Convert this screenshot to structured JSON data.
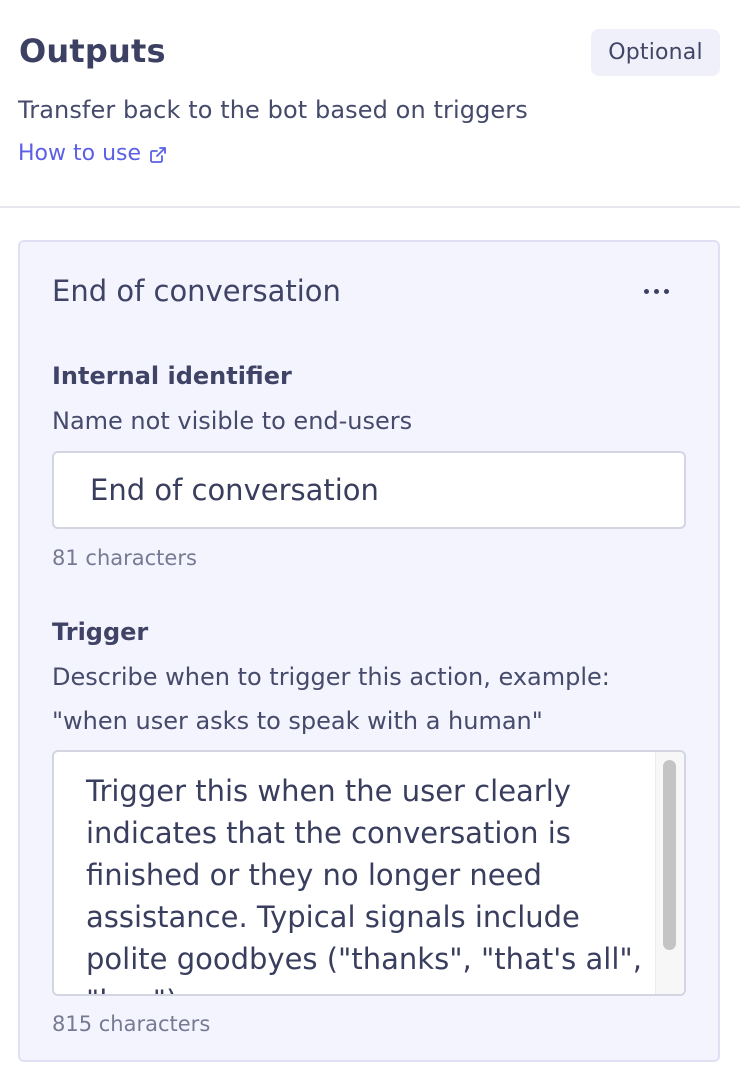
{
  "header": {
    "title": "Outputs",
    "badge": "Optional",
    "subtitle": "Transfer back to the bot based on triggers",
    "link_label": "How to use",
    "link_icon": "external-link-icon"
  },
  "card": {
    "title": "End of conversation",
    "menu_icon": "more-horizontal-icon",
    "identifier": {
      "label": "Internal identifier",
      "help": "Name not visible to end-users",
      "value": "End of conversation",
      "count": "81 characters"
    },
    "trigger": {
      "label": "Trigger",
      "help_line1": "Describe when to trigger this action, example:",
      "help_line2": "\"when user asks to speak with a human\"",
      "value": "Trigger this when the user clearly indicates that the conversation is finished or they no longer need assistance. Typical signals include polite goodbyes (\"thanks\", \"that's all\", \"bye\")",
      "count": "815 characters"
    }
  },
  "colors": {
    "accent": "#5b60e6",
    "text": "#3f4366",
    "card_bg": "#f3f4fd",
    "badge_bg": "#eff0fa"
  }
}
